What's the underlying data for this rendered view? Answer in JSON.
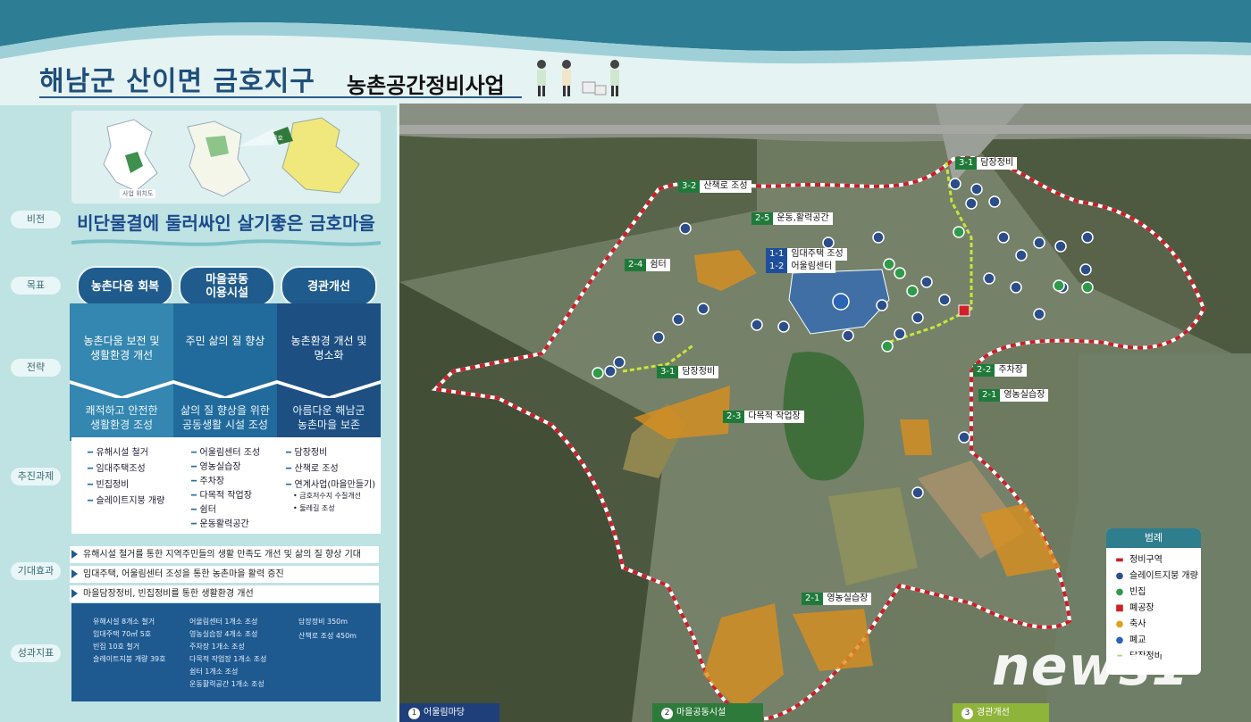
{
  "header": {
    "title_main": "해남군 산이면 금호지구",
    "title_sub": "농촌공간정비사업"
  },
  "left": {
    "row_labels": [
      "비전",
      "목표",
      "전략",
      "추진과제",
      "기대효과",
      "성과지표"
    ],
    "minimap_caption": "사업 위치도",
    "minimap_badge": "금호",
    "vision": "비단물결에 둘러싸인 살기좋은 금호마을",
    "goals": [
      "농촌다움 회복",
      "마을공동\n이용시설",
      "경관개선"
    ],
    "strategy_top": [
      "농촌다움 보전 및\n생활환경 개선",
      "주민 삶의 질 향상",
      "농촌환경 개선 및\n명소화"
    ],
    "strategy_bottom": [
      "쾌적하고 안전한\n생활환경 조성",
      "삶의 질 향상을 위한\n공동생활 시설 조성",
      "아름다운 해남군\n농촌마을 보존"
    ],
    "tasks_col1": [
      "유해시설 철거",
      "임대주택조성",
      "빈집정비",
      "슬레이트지붕 개량"
    ],
    "tasks_col2": [
      "어울림센터 조성",
      "영농실습장",
      "주차장",
      "다목적 작업장",
      "쉼터",
      "운동활력공간"
    ],
    "tasks_col3": [
      "담장정비",
      "산책로 조성",
      "연계사업(마을만들기)"
    ],
    "tasks_col3_sub": [
      "• 금호저수지 수질개선",
      "• 둘레길 조성"
    ],
    "effects": [
      "유해시설 철거를 통한 지역주민들의 생활 만족도 개선 및 삶의 질 향상 기대",
      "임대주택, 어울림센터 조성을 통한 농촌마을 활력 증진",
      "마을담장정비, 빈집정비를 통한 생활환경 개선"
    ],
    "results_col1": [
      "유해시설 8개소 철거",
      "임대주택 70㎡ 5호",
      "빈집 10호 철거",
      "슬레이트지붕 개량 39호"
    ],
    "results_col2": [
      "어울림센터 1개소 조성",
      "영농실습장 4개소 조성",
      "주차장 1개소 조성",
      "다목적 작업장 1개소 조성",
      "쉼터 1개소 조성",
      "운동활력공간 1개소 조성"
    ],
    "results_col3": [
      "담장정비 350m",
      "산책로 조성 450m"
    ]
  },
  "map": {
    "labels": [
      {
        "code": "3-1",
        "text": "담장정비",
        "style": "g"
      },
      {
        "code": "3-2",
        "text": "산책로 조성",
        "style": "g"
      },
      {
        "code": "2-5",
        "text": "운동,활력공간",
        "style": "g"
      },
      {
        "code": "1-1",
        "text": "임대주택 조성",
        "style": "b"
      },
      {
        "code": "1-2",
        "text": "어울림센터",
        "style": "b"
      },
      {
        "code": "2-4",
        "text": "쉼터",
        "style": "g"
      },
      {
        "code": "3-1",
        "text": "담장정비",
        "style": "g"
      },
      {
        "code": "2-3",
        "text": "다목적 작업장",
        "style": "g"
      },
      {
        "code": "2-2",
        "text": "주차장",
        "style": "g"
      },
      {
        "code": "2-1",
        "text": "영농실습장",
        "style": "g"
      },
      {
        "code": "2-1",
        "text": "영농실습장",
        "style": "g"
      }
    ],
    "legend": {
      "title": "범례",
      "items": [
        {
          "label": "정비구역",
          "icon": "boundary-line"
        },
        {
          "label": "슬레이트지붕 개량",
          "icon": "roof-icon"
        },
        {
          "label": "빈집",
          "icon": "house-icon"
        },
        {
          "label": "폐공장",
          "icon": "factory-icon"
        },
        {
          "label": "축사",
          "icon": "barn-icon"
        },
        {
          "label": "폐교",
          "icon": "school-icon"
        },
        {
          "label": "담장정비",
          "icon": "fence-line"
        }
      ]
    },
    "tabs": [
      {
        "num": "1",
        "label": "어울림마당",
        "color": "#1e3f7a"
      },
      {
        "num": "2",
        "label": "마을공동시설",
        "color": "#2e7a3a"
      },
      {
        "num": "3",
        "label": "경관개선",
        "color": "#8fb43a"
      }
    ]
  },
  "watermark": "news1"
}
